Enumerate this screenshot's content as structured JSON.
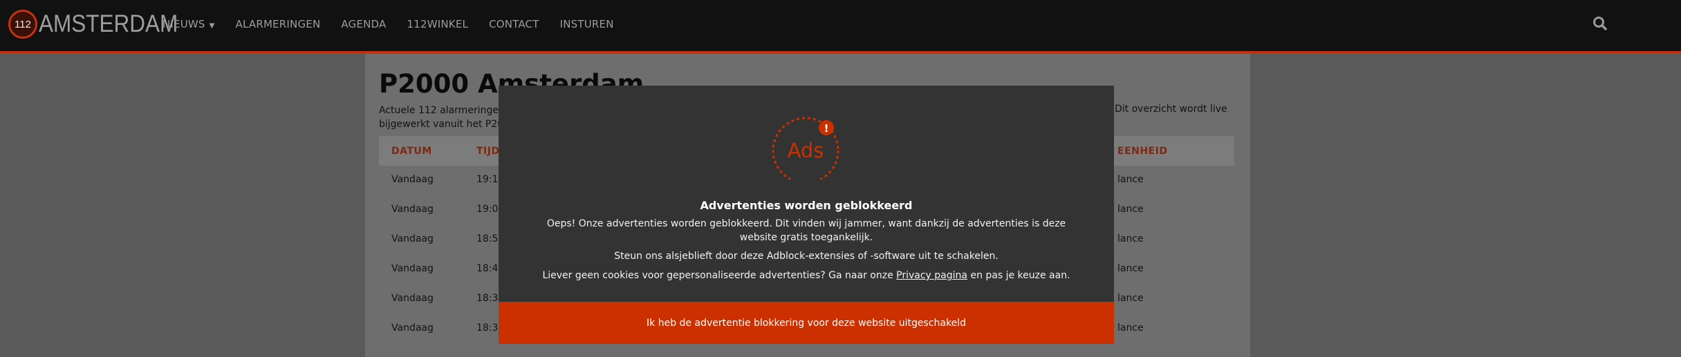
{
  "brand": {
    "badge_text": "112",
    "wordmark": "AMSTERDAM",
    "accent": "#c53211"
  },
  "nav": {
    "items": [
      {
        "label": "NIEUWS",
        "has_dropdown": true,
        "caret": "▼"
      },
      {
        "label": "ALARMERINGEN"
      },
      {
        "label": "AGENDA"
      },
      {
        "label": "112WINKEL"
      },
      {
        "label": "CONTACT"
      },
      {
        "label": "INSTUREN"
      }
    ],
    "search_icon": "search-icon"
  },
  "page": {
    "title": "P2000 Amsterdam",
    "intro_line1": "Actuele 112 alarmeringen",
    "intro_line2": "bijgewerkt vanuit het P200",
    "intro_right": "Dit overzicht wordt live"
  },
  "table": {
    "columns": {
      "date": "DATUM",
      "time": "TIJD",
      "unit": "EENHEID"
    },
    "rows": [
      {
        "date": "Vandaag",
        "time": "19:1",
        "unit": "lance"
      },
      {
        "date": "Vandaag",
        "time": "19:0",
        "unit": "lance"
      },
      {
        "date": "Vandaag",
        "time": "18:5",
        "unit": "lance"
      },
      {
        "date": "Vandaag",
        "time": "18:4",
        "unit": "lance"
      },
      {
        "date": "Vandaag",
        "time": "18:3",
        "unit": "lance"
      },
      {
        "date": "Vandaag",
        "time": "18:3",
        "unit": "lance"
      }
    ]
  },
  "modal": {
    "badge_text": "Ads",
    "badge_alert": "!",
    "heading": "Advertenties worden geblokkeerd",
    "paragraph1": "Oeps! Onze advertenties worden geblokkeerd. Dit vinden wij jammer, want dankzij de advertenties is deze website gratis toegankelijk.",
    "paragraph2": "Steun ons alsjeblieft door deze Adblock-extensies of -software uit te schakelen.",
    "paragraph3_before": "Liever geen cookies voor gepersonaliseerde advertenties? Ga naar onze",
    "paragraph3_link": "Privacy pagina",
    "paragraph3_after": "en pas je keuze aan.",
    "cta_label": "Ik heb de advertentie blokkering voor deze website uitgeschakeld",
    "accent": "#cc2f00"
  }
}
